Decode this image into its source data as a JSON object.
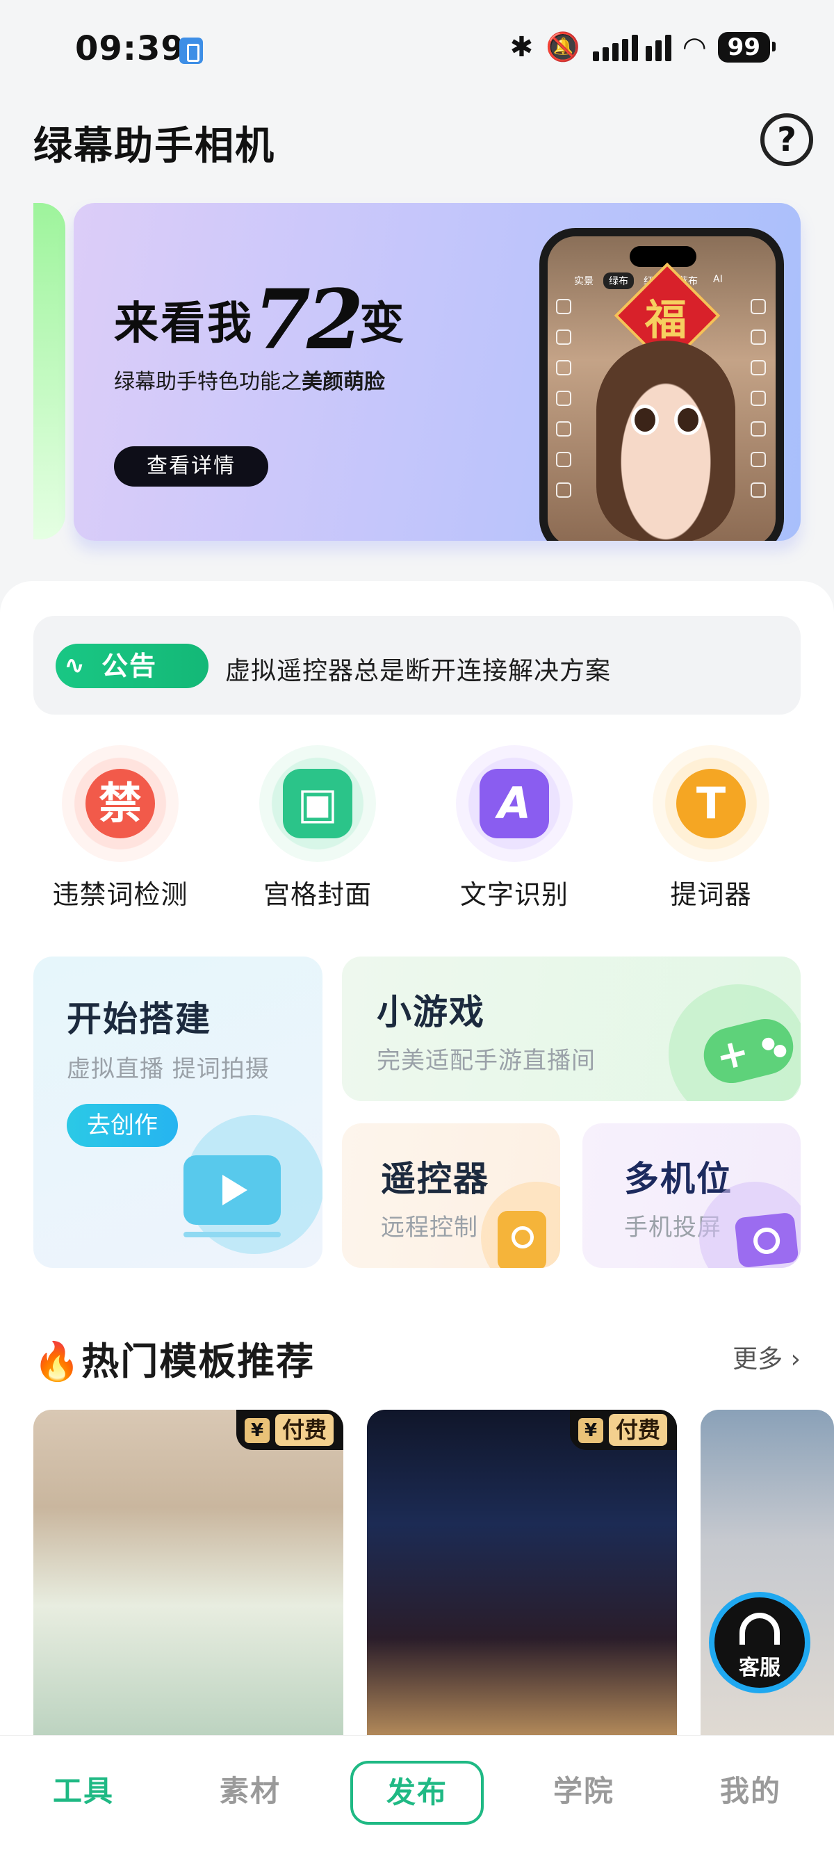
{
  "status_bar": {
    "time": "09:39",
    "battery": "99"
  },
  "header": {
    "title": "绿幕助手相机",
    "help_glyph": "?"
  },
  "banner": {
    "title_prefix": "来看我",
    "title_number": "72",
    "title_suffix": "变",
    "subtitle_prefix": "绿幕助手特色功能之",
    "subtitle_bold": "美颜萌脸",
    "button": "查看详情",
    "phone_tabs": [
      "实景",
      "绿布",
      "红布",
      "蓝布",
      "AI"
    ],
    "phone_sticker": "福"
  },
  "notice": {
    "badge": "公告",
    "text": "虚拟遥控器总是断开连接解决方案"
  },
  "tools": [
    {
      "label": "违禁词检测",
      "icon": "ban-word-icon",
      "glyph": "禁",
      "color": "#f25a4a"
    },
    {
      "label": "宫格封面",
      "icon": "grid-cover-icon",
      "glyph": "▣",
      "color": "#2bc489"
    },
    {
      "label": "文字识别",
      "icon": "text-recognition-icon",
      "glyph": "A",
      "color": "#8a5df0"
    },
    {
      "label": "提词器",
      "icon": "teleprompter-icon",
      "glyph": "T",
      "color": "#f5a623"
    }
  ],
  "cards": {
    "build": {
      "title": "开始搭建",
      "subtitle": "虚拟直播 提词拍摄",
      "button": "去创作"
    },
    "game": {
      "title": "小游戏",
      "subtitle": "完美适配手游直播间"
    },
    "remote": {
      "title": "遥控器",
      "subtitle": "远程控制"
    },
    "multicam": {
      "title": "多机位",
      "subtitle": "手机投屏"
    }
  },
  "section": {
    "title": "热门模板推荐",
    "more": "更多"
  },
  "templates": [
    {
      "badge": "付费",
      "currency": "¥"
    },
    {
      "badge": "付费",
      "currency": "¥"
    },
    {
      "badge": "",
      "currency": ""
    }
  ],
  "service": {
    "label": "客服"
  },
  "tabbar": {
    "tools": "工具",
    "materials": "素材",
    "publish": "发布",
    "academy": "学院",
    "mine": "我的"
  },
  "colors": {
    "accent": "#1fb984",
    "banner": "#c5c6fb"
  }
}
